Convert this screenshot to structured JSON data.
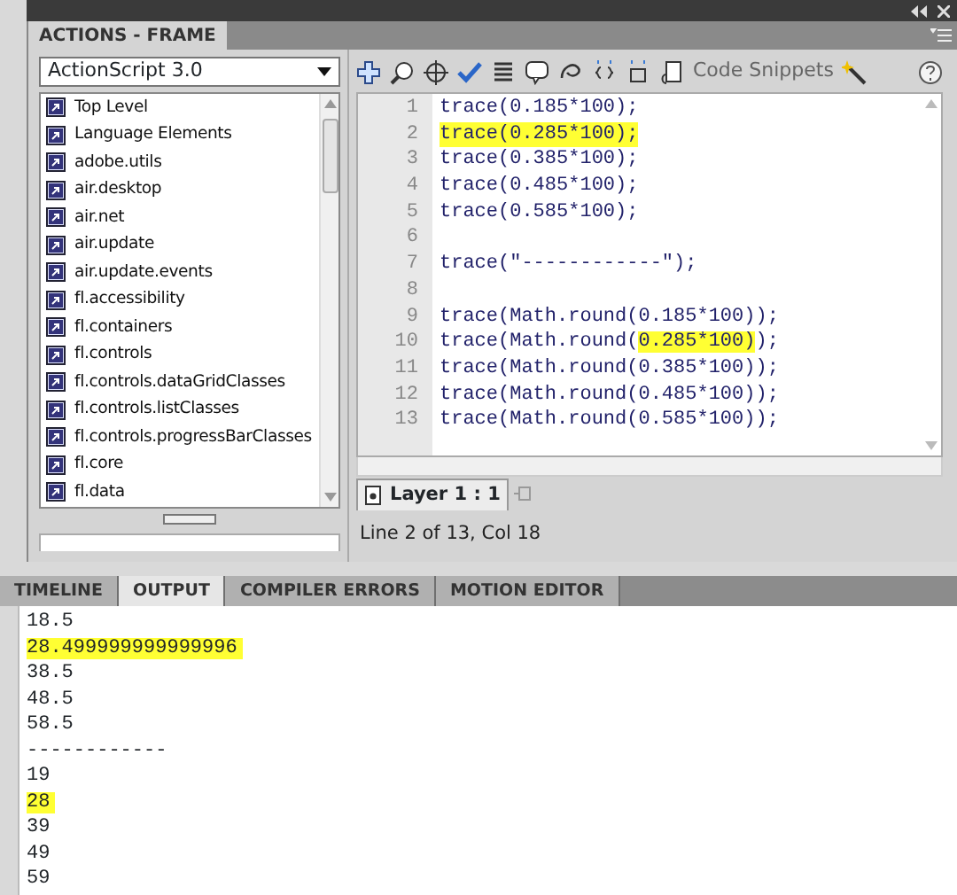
{
  "panel": {
    "title": "ACTIONS - FRAME"
  },
  "language_select": {
    "value": "ActionScript 3.0"
  },
  "library_items": [
    {
      "label": "Top Level"
    },
    {
      "label": "Language Elements"
    },
    {
      "label": "adobe.utils"
    },
    {
      "label": "air.desktop"
    },
    {
      "label": "air.net"
    },
    {
      "label": "air.update"
    },
    {
      "label": "air.update.events"
    },
    {
      "label": "fl.accessibility"
    },
    {
      "label": "fl.containers"
    },
    {
      "label": "fl.controls"
    },
    {
      "label": "fl.controls.dataGridClasses"
    },
    {
      "label": "fl.controls.listClasses"
    },
    {
      "label": "fl.controls.progressBarClasses"
    },
    {
      "label": "fl.core"
    },
    {
      "label": "fl.data"
    }
  ],
  "toolbar": {
    "snippets_label": "Code Snippets"
  },
  "code_lines": [
    {
      "number": "1",
      "segments": [
        {
          "text": "trace(0.185*100);",
          "highlighted": false
        }
      ]
    },
    {
      "number": "2",
      "segments": [
        {
          "text": "trace(0.285*100);",
          "highlighted": true
        }
      ]
    },
    {
      "number": "3",
      "segments": [
        {
          "text": "trace(0.385*100);",
          "highlighted": false
        }
      ]
    },
    {
      "number": "4",
      "segments": [
        {
          "text": "trace(0.485*100);",
          "highlighted": false
        }
      ]
    },
    {
      "number": "5",
      "segments": [
        {
          "text": "trace(0.585*100);",
          "highlighted": false
        }
      ]
    },
    {
      "number": "6"
    },
    {
      "number": "7",
      "segments": [
        {
          "text": "trace(\"------------\");",
          "highlighted": false
        }
      ]
    },
    {
      "number": "8"
    },
    {
      "number": "9",
      "segments": [
        {
          "text": "trace(Math.round(0.185*100));",
          "highlighted": false
        }
      ]
    },
    {
      "number": "10",
      "segments": [
        {
          "text": "trace(Math.round(",
          "highlighted": false
        },
        {
          "text": "0.285*100)",
          "highlighted": true
        },
        {
          "text": ");",
          "highlighted": false
        }
      ]
    },
    {
      "number": "11",
      "segments": [
        {
          "text": "trace(Math.round(0.385*100));",
          "highlighted": false
        }
      ]
    },
    {
      "number": "12",
      "segments": [
        {
          "text": "trace(Math.round(0.485*100));",
          "highlighted": false
        }
      ]
    },
    {
      "number": "13",
      "segments": [
        {
          "text": "trace(Math.round(0.585*100));",
          "highlighted": false
        }
      ]
    }
  ],
  "layer_tab": {
    "label": "Layer 1 : 1",
    "selected": true
  },
  "status": "Line 2 of 13, Col 18",
  "bottom_tabs": [
    {
      "label": "TIMELINE",
      "selected": false
    },
    {
      "label": "OUTPUT",
      "selected": true
    },
    {
      "label": "COMPILER ERRORS",
      "selected": false
    },
    {
      "label": "MOTION EDITOR",
      "selected": false
    }
  ],
  "output_lines": [
    {
      "text": "18.5",
      "highlighted": false
    },
    {
      "text": "28.499999999999996",
      "highlighted": true
    },
    {
      "text": "38.5",
      "highlighted": false
    },
    {
      "text": "48.5",
      "highlighted": false
    },
    {
      "text": "58.5",
      "highlighted": false
    },
    {
      "text": "------------",
      "highlighted": false
    },
    {
      "text": "19",
      "highlighted": false
    },
    {
      "text": "28",
      "highlighted": true
    },
    {
      "text": "39",
      "highlighted": false
    },
    {
      "text": "49",
      "highlighted": false
    },
    {
      "text": "59",
      "highlighted": false
    }
  ]
}
